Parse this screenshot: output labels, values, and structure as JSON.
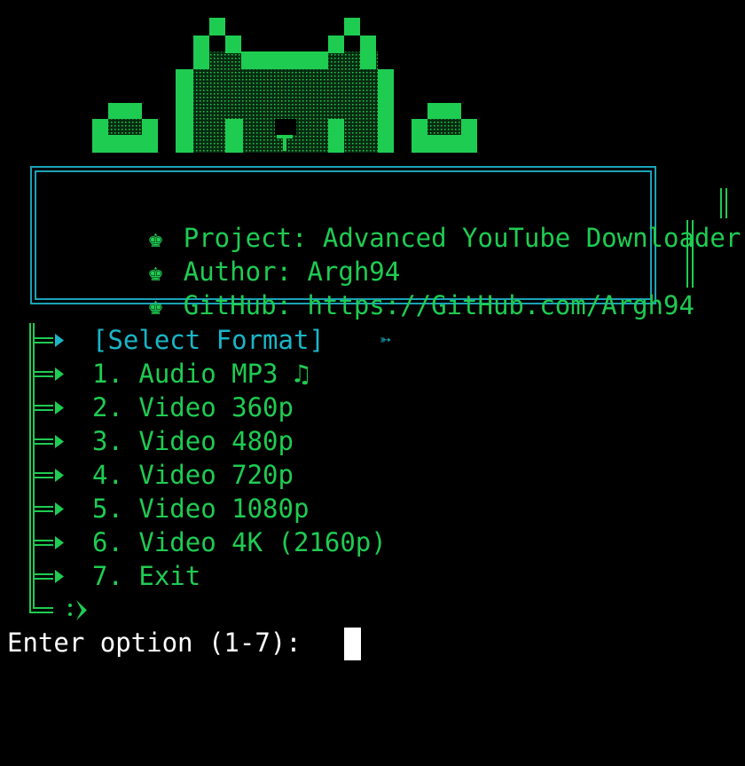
{
  "colors": {
    "background": "#000000",
    "green": "#1fcc52",
    "cyan": "#1ab6c8",
    "frame": "#1aa3b8",
    "white": "#ffffff"
  },
  "info": {
    "bullet_icon": "crown-icon",
    "bullet_glyph": "♚",
    "lines": [
      "Project: Advanced YouTube Downloader",
      "Author: Argh94",
      "GitHub: https://GitHub.com/Argh94"
    ]
  },
  "menu": {
    "header": "[Select Format]",
    "header_arrow": "➳",
    "items": [
      "1. Audio MP3 ♫",
      "2. Video 360p",
      "3. Video 480p",
      "4. Video 720p",
      "5. Video 1080p",
      "6. Video 4K (2160p)",
      "7. Exit"
    ],
    "final_connector": ":"
  },
  "prompt": {
    "text": "Enter option (1-7): "
  }
}
